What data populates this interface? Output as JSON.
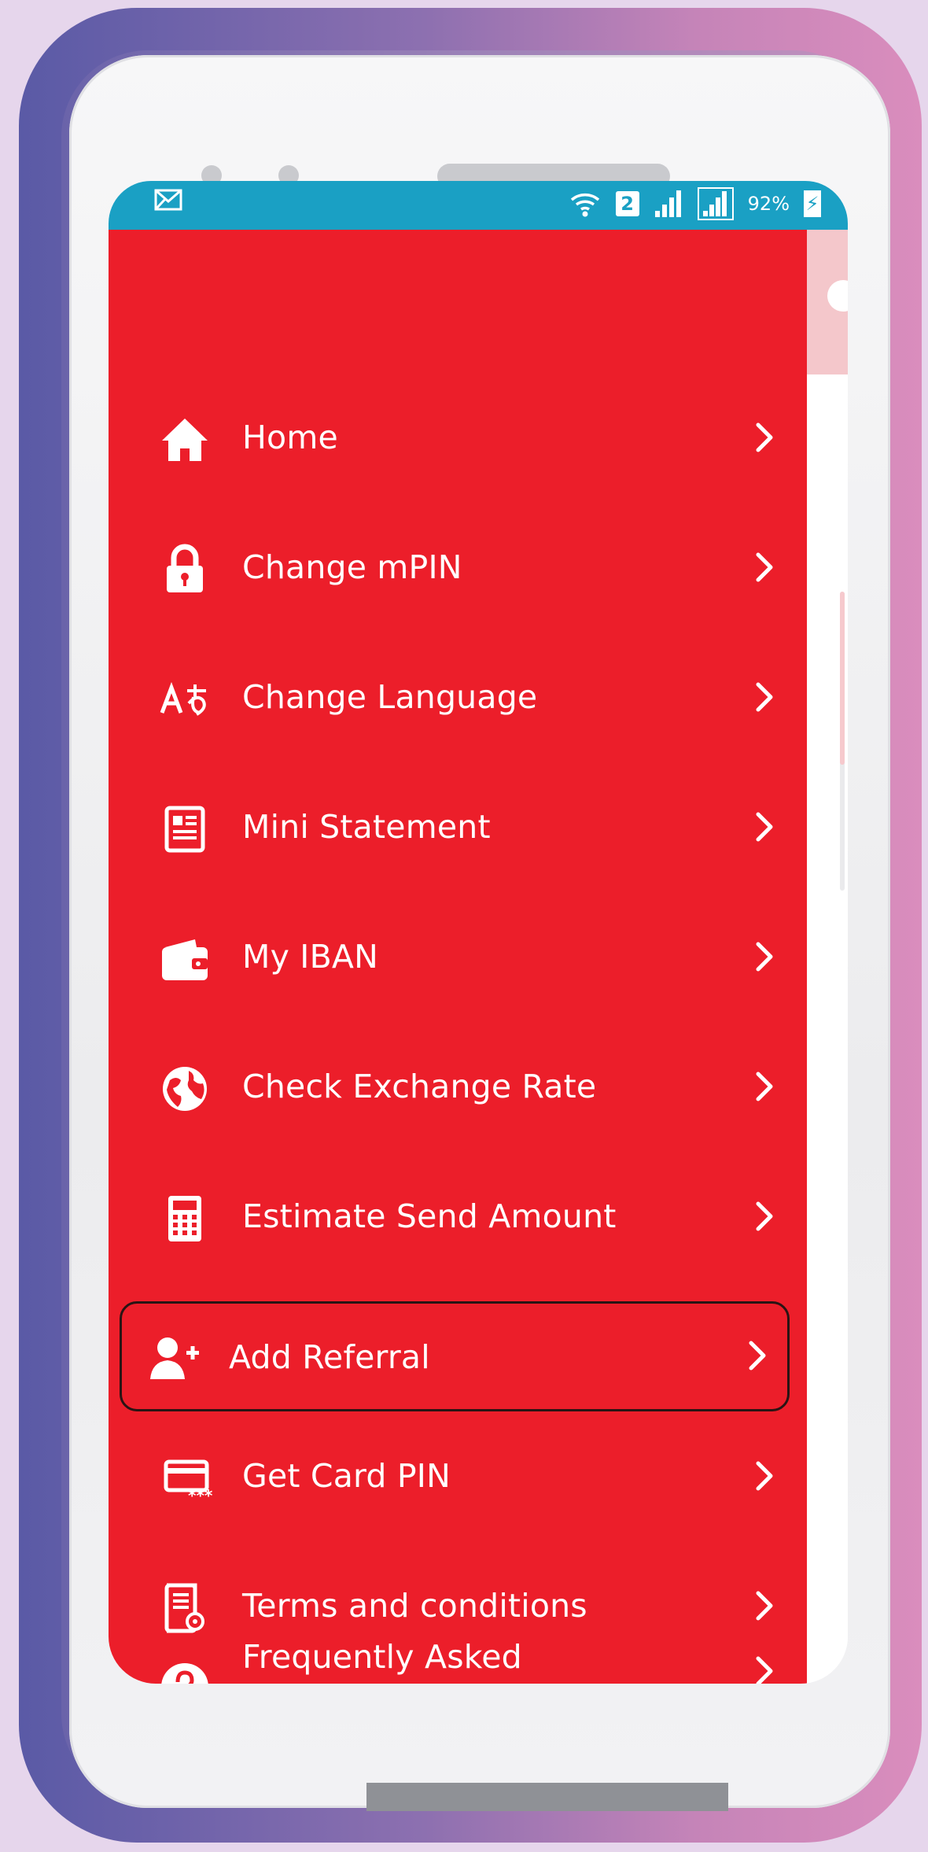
{
  "status_bar": {
    "left_icon": "mail-icon",
    "sim_number": "2",
    "battery_percent": "92%",
    "icons": [
      "wifi-icon",
      "sim-icon",
      "signal-icon",
      "signal-icon",
      "battery-charging-icon"
    ]
  },
  "menu": {
    "items": [
      {
        "label": "Home",
        "icon": "home-icon"
      },
      {
        "label": "Change mPIN",
        "icon": "lock-icon"
      },
      {
        "label": "Change Language",
        "icon": "translate-icon"
      },
      {
        "label": "Mini Statement",
        "icon": "statement-icon"
      },
      {
        "label": "My IBAN",
        "icon": "wallet-icon"
      },
      {
        "label": "Check Exchange Rate",
        "icon": "globe-icon"
      },
      {
        "label": "Estimate Send Amount",
        "icon": "calculator-icon"
      },
      {
        "label": "Add Referral",
        "icon": "add-user-icon",
        "highlighted": true
      },
      {
        "label": "Get Card PIN",
        "icon": "card-pin-icon"
      },
      {
        "label": "Terms and conditions",
        "icon": "certificate-document-icon"
      },
      {
        "label": "Frequently Asked",
        "icon": "faq-icon"
      }
    ]
  },
  "colors": {
    "drawer_background": "#ec1e2a",
    "status_bar": "#1aa0c4",
    "text": "#ffffff",
    "highlight_border": "#2a1414"
  }
}
